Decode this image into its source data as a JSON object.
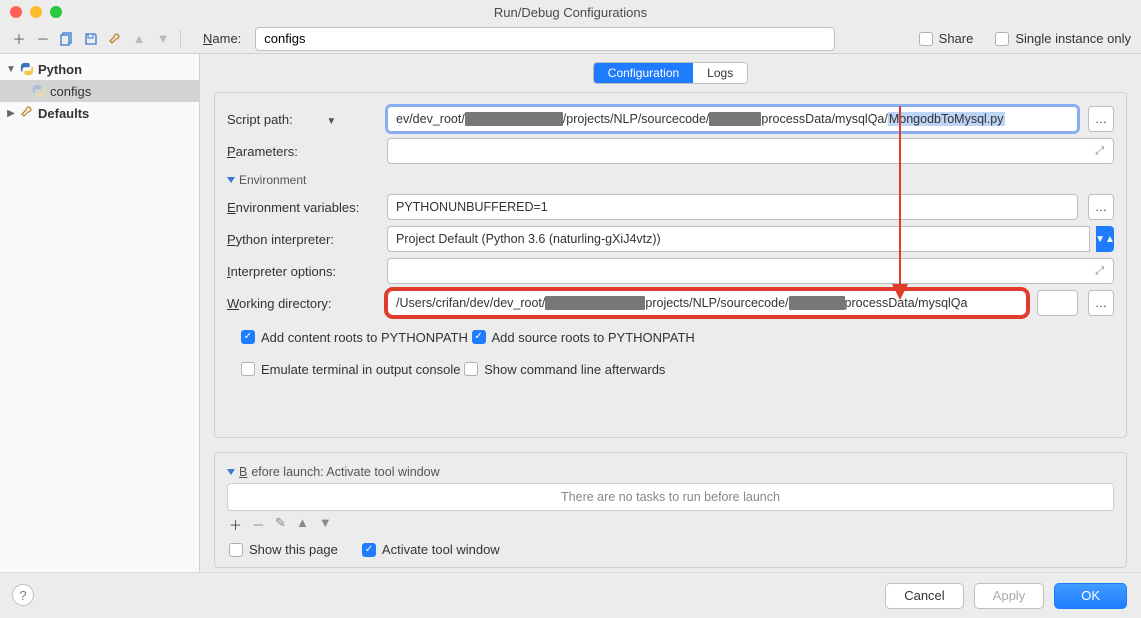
{
  "window": {
    "title": "Run/Debug Configurations"
  },
  "name_row": {
    "label": "Name:",
    "value": "configs",
    "share": "Share",
    "single_instance": "Single instance only"
  },
  "tree": {
    "python": "Python",
    "configs": "configs",
    "defaults": "Defaults"
  },
  "tabs": {
    "configuration": "Configuration",
    "logs": "Logs"
  },
  "script": {
    "label": "Script path:",
    "pre1": "ev/dev_root/",
    "mid1": "/projects/NLP/sourcecode/",
    "post1": "processData/mysqlQa/",
    "highlight": "MongodbToMysql.py"
  },
  "params_label": "Parameters:",
  "env_section": "Environment",
  "envvars": {
    "label": "Environment variables:",
    "value": "PYTHONUNBUFFERED=1"
  },
  "interpreter": {
    "label": "Python interpreter:",
    "value": "Project Default (Python 3.6 (naturling-gXiJ4vtz))"
  },
  "interp_opts_label": "Interpreter options:",
  "workdir": {
    "label": "Working directory:",
    "pre1": "/Users/crifan/dev/dev_root/",
    "mid1": "projects/NLP/sourcecode/",
    "post1": "processData/mysqlQa"
  },
  "checks": {
    "content_roots": "Add content roots to PYTHONPATH",
    "source_roots": "Add source roots to PYTHONPATH",
    "emulate": "Emulate terminal in output console",
    "show_cmd": "Show command line afterwards"
  },
  "before": {
    "header": "Before launch: Activate tool window",
    "no_tasks": "There are no tasks to run before launch",
    "show_page": "Show this page",
    "activate": "Activate tool window"
  },
  "footer": {
    "cancel": "Cancel",
    "apply": "Apply",
    "ok": "OK"
  }
}
